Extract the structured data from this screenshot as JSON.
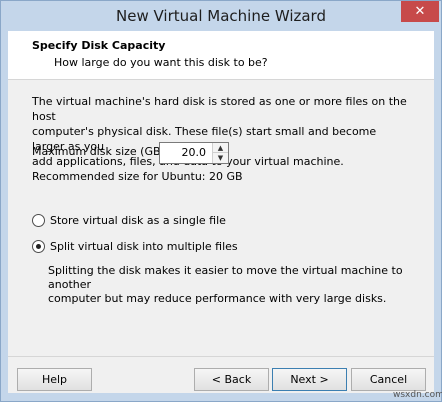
{
  "window": {
    "title": "New Virtual Machine Wizard",
    "close_glyph": "✕"
  },
  "header": {
    "title": "Specify Disk Capacity",
    "subtitle": "How large do you want this disk to be?"
  },
  "body": {
    "description_lines": [
      "The virtual machine's hard disk is stored as one or more files on the host",
      "computer's physical disk. These file(s) start small and become larger as you",
      "add applications, files, and data to your virtual machine."
    ],
    "max_size_label": "Maximum disk size (GB):",
    "max_size_value": "20.0",
    "recommended": "Recommended size for Ubuntu: 20 GB",
    "options": [
      {
        "label": "Store virtual disk as a single file",
        "selected": false
      },
      {
        "label": "Split virtual disk into multiple files",
        "selected": true
      }
    ],
    "split_description_lines": [
      "Splitting the disk makes it easier to move the virtual machine to another",
      "computer but may reduce performance with very large disks."
    ]
  },
  "footer": {
    "help": "Help",
    "back": "< Back",
    "next": "Next >",
    "cancel": "Cancel"
  },
  "watermark": "wsxdn.com"
}
